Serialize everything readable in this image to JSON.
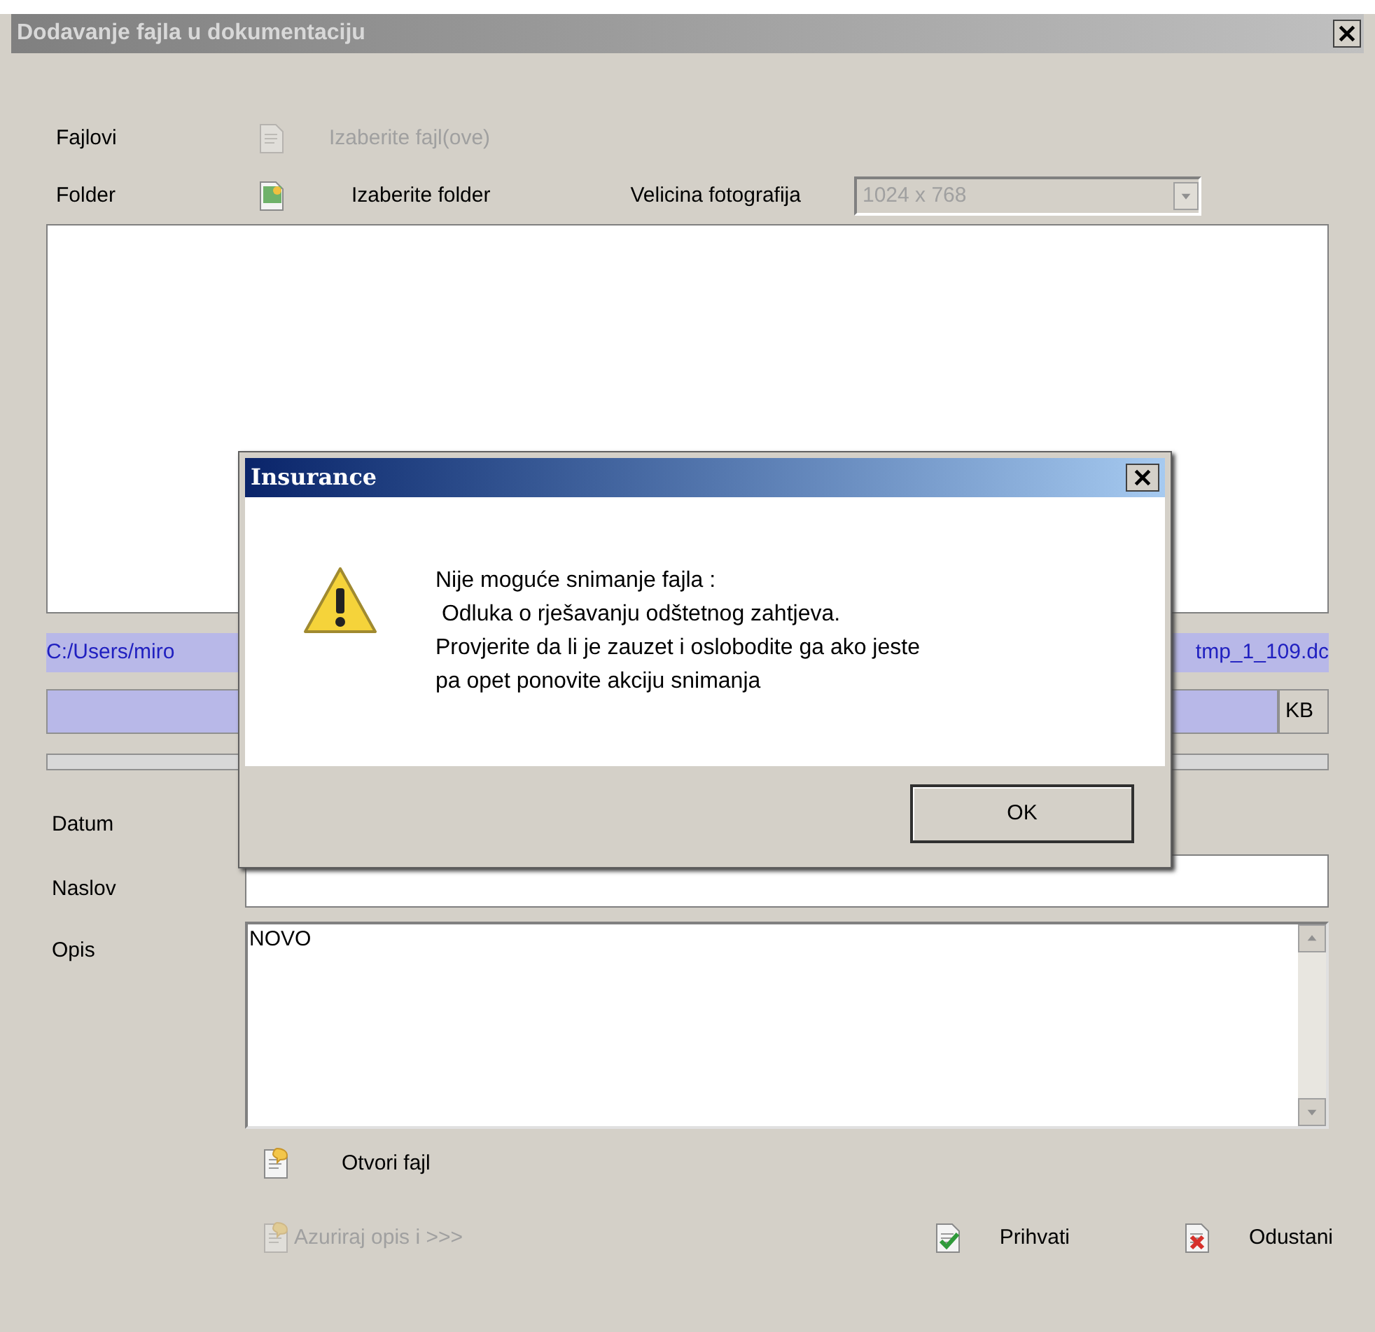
{
  "window": {
    "title": "Dodavanje fajla u dokumentaciju"
  },
  "files_row": {
    "label": "Fajlovi",
    "button": "Izaberite fajl(ove)",
    "disabled": true
  },
  "folder_row": {
    "label": "Folder",
    "button": "Izaberite folder",
    "size_label": "Velicina fotografija",
    "size_value": "1024 x 768",
    "size_disabled": true
  },
  "path": {
    "start": "C:/Users/miro",
    "end": "tmp_1_109.dc"
  },
  "size_unit": "KB",
  "progress": {
    "level": 0
  },
  "fields": [
    {
      "kind": "date",
      "label": "Datum"
    },
    {
      "kind": "text",
      "label": "Naslov"
    },
    {
      "kind": "memo",
      "label": "Opis",
      "value": "NOVO"
    }
  ],
  "open_file": "Otvori fajl",
  "actions": [
    {
      "kind": "update",
      "label": "Azuriraj opis i >>>",
      "disabled": true
    },
    {
      "kind": "accept",
      "label": "Prihvati",
      "disabled": false
    },
    {
      "kind": "cancel",
      "label": "Odustani",
      "disabled": false
    }
  ],
  "dialog": {
    "title": "Insurance",
    "lines": [
      "Nije moguće snimanje fajla :",
      " Odluka o rješavanju odštetnog zahtjeva.",
      "Provjerite da li je zauzet i oslobodite ga ako jeste",
      "pa opet ponovite akciju snimanja"
    ],
    "button": "OK"
  }
}
